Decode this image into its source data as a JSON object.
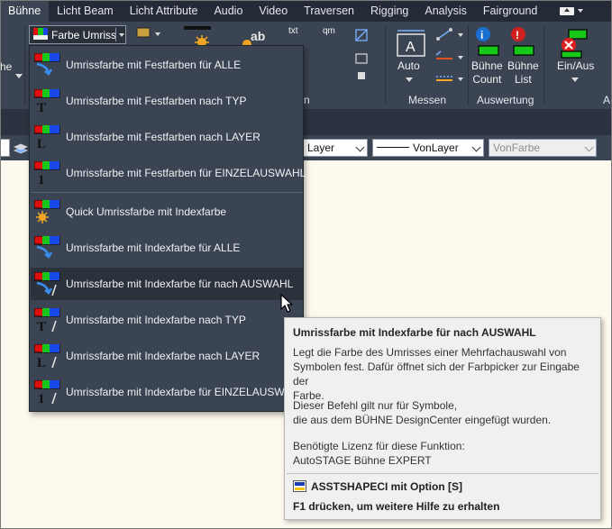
{
  "ribbon_tabs": [
    "Bühne",
    "Licht Beam",
    "Licht Attribute",
    "Audio",
    "Video",
    "Traversen",
    "Rigging",
    "Analysis",
    "Fairground"
  ],
  "active_tab": "Bühne",
  "split_button": {
    "label": "Farbe Umriss"
  },
  "ribbon": {
    "left_partial": "he",
    "measure_label": "Auto",
    "measure_group": "Messen",
    "eval_btn1": [
      "Bühne",
      "Count"
    ],
    "eval_btn2": [
      "Bühne",
      "List"
    ],
    "eval_group": "Auswertung",
    "toggle_label": "Ein/Aus",
    "partial_n": "n",
    "partial_a": "A",
    "small_txt": "txt",
    "small_qm": "qm",
    "small_ab": "ab"
  },
  "property_bar": {
    "layer": "Layer",
    "linetype": "VonLayer",
    "color": "VonFarbe"
  },
  "menu": {
    "items": [
      {
        "label": "Umrissfarbe mit Festfarben für ALLE",
        "icon": "arrow-all-icon",
        "group": 1
      },
      {
        "label": "Umrissfarbe mit Festfarben nach TYP",
        "icon": "type-icon",
        "group": 1
      },
      {
        "label": "Umrissfarbe mit Festfarben nach LAYER",
        "icon": "layer-icon",
        "group": 1
      },
      {
        "label": "Umrissfarbe mit Festfarben für EINZELAUSWAHL",
        "icon": "single-icon",
        "group": 1
      },
      {
        "label": "Quick Umrissfarbe mit Indexfarbe",
        "icon": "sun-icon",
        "group": 2
      },
      {
        "label": "Umrissfarbe mit Indexfarbe für ALLE",
        "icon": "arrow-all-icon",
        "group": 2
      },
      {
        "label": "Umrissfarbe mit Indexfarbe für nach AUSWAHL",
        "icon": "selection-icon",
        "group": 2
      },
      {
        "label": "Umrissfarbe mit Indexfarbe nach TYP",
        "icon": "type-icon",
        "group": 2
      },
      {
        "label": "Umrissfarbe mit Indexfarbe nach LAYER",
        "icon": "layer-icon",
        "group": 2
      },
      {
        "label": "Umrissfarbe mit Indexfarbe für EINZELAUSWAHL",
        "icon": "single-icon",
        "group": 2
      }
    ]
  },
  "tooltip": {
    "title": "Umrissfarbe mit Indexfarbe für nach AUSWAHL",
    "desc1": "Legt die Farbe des Umrisses einer Mehrfachauswahl von",
    "desc2": "Symbolen fest. Dafür öffnet sich der Farbpicker zur Eingabe der",
    "desc3": "Farbe.",
    "note1": "Dieser Befehl gilt nur für Symbole,",
    "note2": "die aus dem BÜHNE DesignCenter eingefügt wurden.",
    "license1": "Benötigte Lizenz für diese Funktion:",
    "license2": "AutoSTAGE Bühne EXPERT",
    "command": "ASSTSHAPECI mit Option [S]",
    "help": "F1 drücken, um weitere Hilfe zu erhalten"
  },
  "colors": {
    "ribbon_bg": "#3b4453",
    "tab_bar_bg": "#252a37",
    "menu_bg": "#3b4453",
    "menu_hover": "#2c323c",
    "tooltip_bg": "#f0f0ee",
    "canvas_bg": "#fdf9ee",
    "swatch_red": "#e01010",
    "swatch_green": "#18c818",
    "swatch_blue": "#1848e8"
  }
}
